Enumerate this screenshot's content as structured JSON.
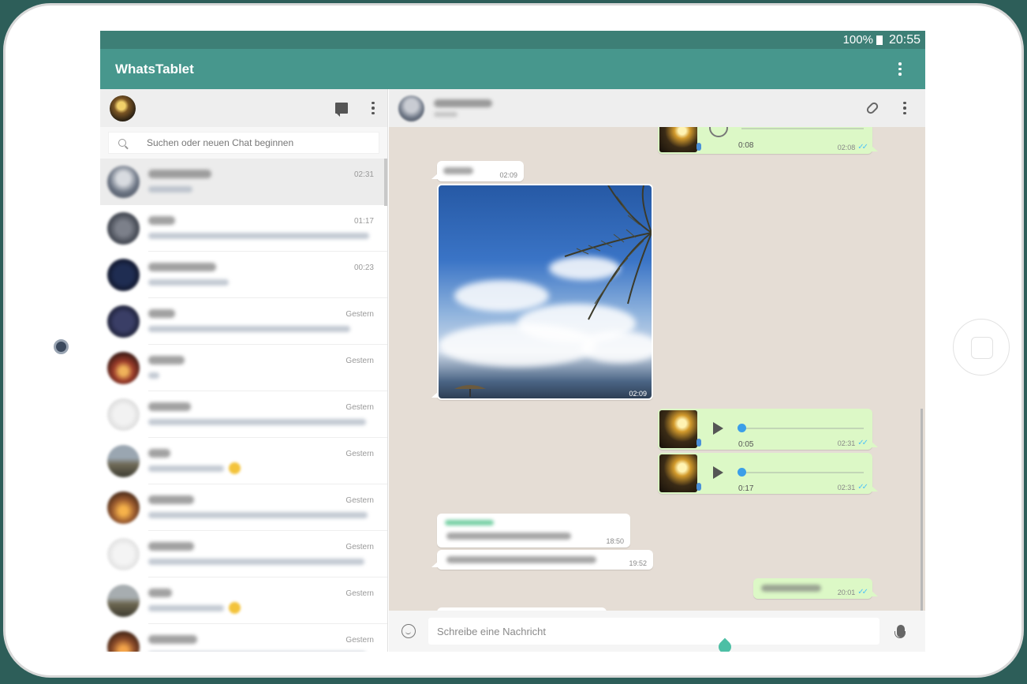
{
  "status": {
    "battery": "100%",
    "clock": "20:55"
  },
  "app": {
    "title": "WhatsTablet"
  },
  "search": {
    "placeholder": "Suchen oder neuen Chat beginnen"
  },
  "chats": [
    {
      "time": "02:31",
      "active": true
    },
    {
      "time": "01:17"
    },
    {
      "time": "00:23"
    },
    {
      "time": "Gestern"
    },
    {
      "time": "Gestern"
    },
    {
      "time": "Gestern"
    },
    {
      "time": "Gestern"
    },
    {
      "time": "Gestern"
    },
    {
      "time": "Gestern"
    },
    {
      "time": "Gestern"
    },
    {
      "time": "Gestern"
    }
  ],
  "messages": {
    "voice_top": {
      "duration": "0:08",
      "time": "02:08"
    },
    "in_caption": {
      "time": "02:09"
    },
    "photo": {
      "time": "02:09"
    },
    "voice_1": {
      "duration": "0:05",
      "time": "02:31",
      "progress": 0
    },
    "voice_2": {
      "duration": "0:17",
      "time": "02:31",
      "progress": 0
    },
    "in_text_1": {
      "time": "18:50"
    },
    "in_text_2": {
      "time": "19:52"
    },
    "out_text": {
      "time": "20:01"
    },
    "ticks": "✓✓"
  },
  "compose": {
    "placeholder": "Schreibe eine Nachricht"
  },
  "colors": {
    "header": "#47978d",
    "statusbar": "#3d7f76",
    "outgoing": "#dcf8c6",
    "wallpaper": "#e5ddd5"
  }
}
